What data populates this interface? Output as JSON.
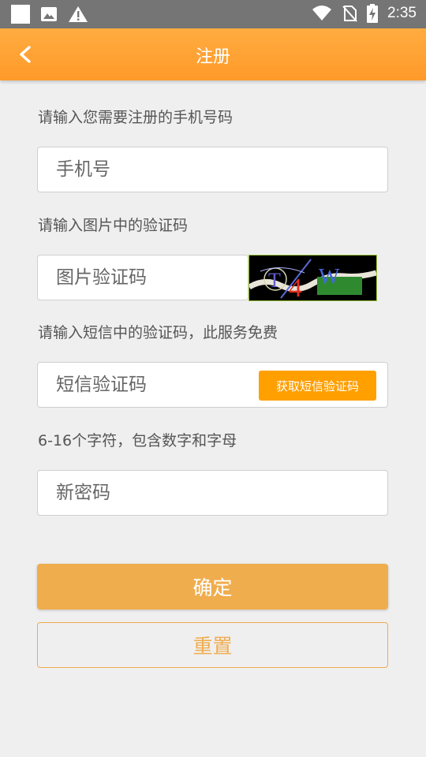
{
  "status_bar": {
    "time": "2:35",
    "left_icons": [
      "square-icon",
      "image-icon",
      "warning-icon"
    ],
    "right_icons": [
      "wifi-icon",
      "no-sim-icon",
      "battery-charging-icon"
    ]
  },
  "app_bar": {
    "title": "注册",
    "back_icon": "chevron-left-icon"
  },
  "form": {
    "phone_label": "请输入您需要注册的手机号码",
    "phone_placeholder": "手机号",
    "captcha_label": "请输入图片中的验证码",
    "captcha_placeholder": "图片验证码",
    "captcha_image_text": "T4W",
    "sms_label": "请输入短信中的验证码，此服务免费",
    "sms_placeholder": "短信验证码",
    "sms_button": "获取短信验证码",
    "password_label": "6-16个字符，包含数字和字母",
    "password_placeholder": "新密码"
  },
  "actions": {
    "confirm": "确定",
    "reset": "重置"
  },
  "colors": {
    "accent": "#ff9f00",
    "appbar": "#ffa233",
    "button": "#f0ad4e",
    "background": "#efefef"
  }
}
